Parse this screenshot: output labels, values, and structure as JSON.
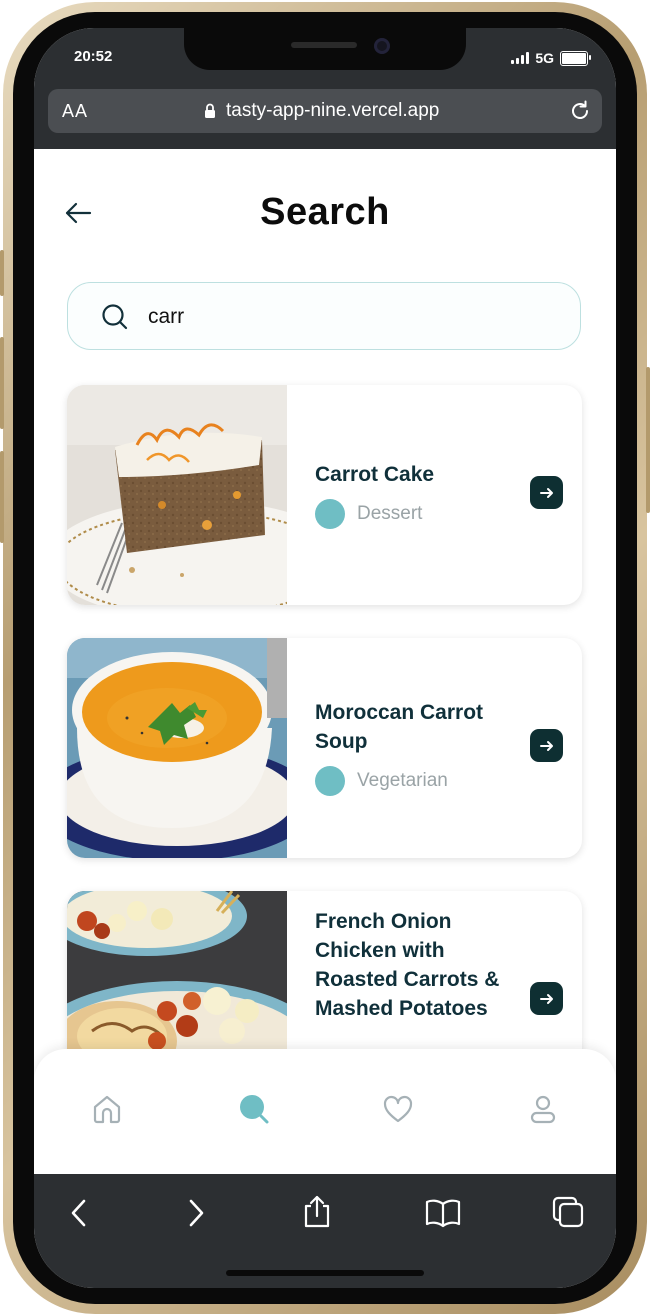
{
  "status_bar": {
    "time": "20:52",
    "network": "5G"
  },
  "browser": {
    "text_size_label": "AA",
    "url": "tasty-app-nine.vercel.app"
  },
  "page": {
    "title": "Search"
  },
  "search": {
    "value": "carr"
  },
  "results": [
    {
      "title": "Carrot Cake",
      "category": "Dessert"
    },
    {
      "title": "Moroccan Carrot Soup",
      "category": "Vegetarian"
    },
    {
      "title": "French Onion Chicken with Roasted Carrots & Mashed Potatoes",
      "category": ""
    }
  ],
  "tabs": [
    {
      "name": "home-icon",
      "active": false
    },
    {
      "name": "search-icon",
      "active": true
    },
    {
      "name": "heart-icon",
      "active": false
    },
    {
      "name": "profile-icon",
      "active": false
    }
  ],
  "colors": {
    "accent": "#6fbec4",
    "dark_teal": "#0e2f32",
    "title_text": "#10303a",
    "muted_text": "#9aa3a6",
    "browser_chrome": "#2c2f32"
  }
}
